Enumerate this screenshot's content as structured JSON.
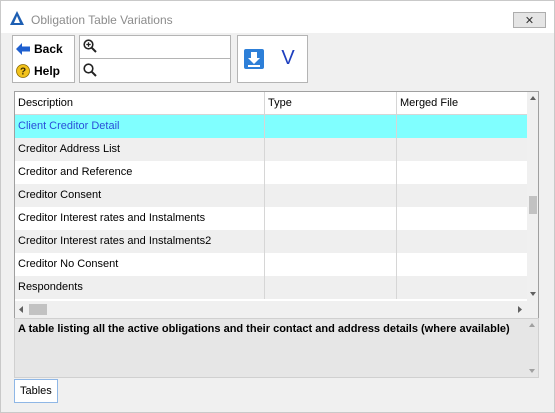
{
  "window": {
    "title": "Obligation Table Variations",
    "close_label": "✕"
  },
  "toolbar": {
    "back_label": "Back",
    "help_label": "Help",
    "zoom_in_value": "",
    "search_value": "",
    "confirm_label": "V"
  },
  "grid": {
    "columns": [
      "Description",
      "Type",
      "Merged File"
    ],
    "rows": [
      {
        "description": "Client Creditor Detail",
        "type": "",
        "merged_file": ""
      },
      {
        "description": "Creditor Address List",
        "type": "",
        "merged_file": ""
      },
      {
        "description": "Creditor and Reference",
        "type": "",
        "merged_file": ""
      },
      {
        "description": "Creditor Consent",
        "type": "",
        "merged_file": ""
      },
      {
        "description": "Creditor Interest rates and Instalments",
        "type": "",
        "merged_file": ""
      },
      {
        "description": "Creditor Interest rates and Instalments2",
        "type": "",
        "merged_file": ""
      },
      {
        "description": "Creditor No Consent",
        "type": "",
        "merged_file": ""
      },
      {
        "description": "Respondents",
        "type": "",
        "merged_file": ""
      }
    ],
    "selected_row": 0
  },
  "description_panel": {
    "text": "A table listing all the active obligations and their contact and address details (where available)"
  },
  "tabs": [
    {
      "label": "Tables",
      "active": true
    }
  ],
  "colors": {
    "selected_row_bg": "#80ffff",
    "selected_row_text": "#2a4fd9",
    "accent_blue": "#1e73d6"
  }
}
